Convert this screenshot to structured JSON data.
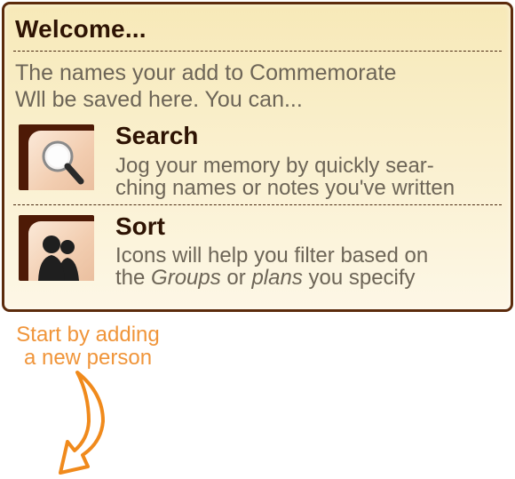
{
  "welcome": {
    "title": "Welcome...",
    "intro_line1": "The names your add to Commemorate",
    "intro_line2": "Wll be saved here. You can..."
  },
  "features": [
    {
      "title": "Search",
      "desc_line1": "Jog your memory by quickly sear-",
      "desc_line2": "ching names or notes you've written",
      "icon": "magnifier-icon"
    },
    {
      "title": "Sort",
      "desc_line1": "Icons will help you filter based on",
      "desc_line2_the": "the",
      "desc_line2_groups": "Groups",
      "desc_line2_or": "or",
      "desc_line2_plans": "plans",
      "desc_line2_end": "you specify",
      "icon": "people-icon"
    }
  ],
  "hint": {
    "line1": "Start by adding",
    "line2": "a new person",
    "icon": "curved-arrow-icon"
  },
  "colors": {
    "border": "#5c2b0c",
    "heading": "#2e1303",
    "body_text": "#6d6557",
    "hint": "#f0953a"
  }
}
